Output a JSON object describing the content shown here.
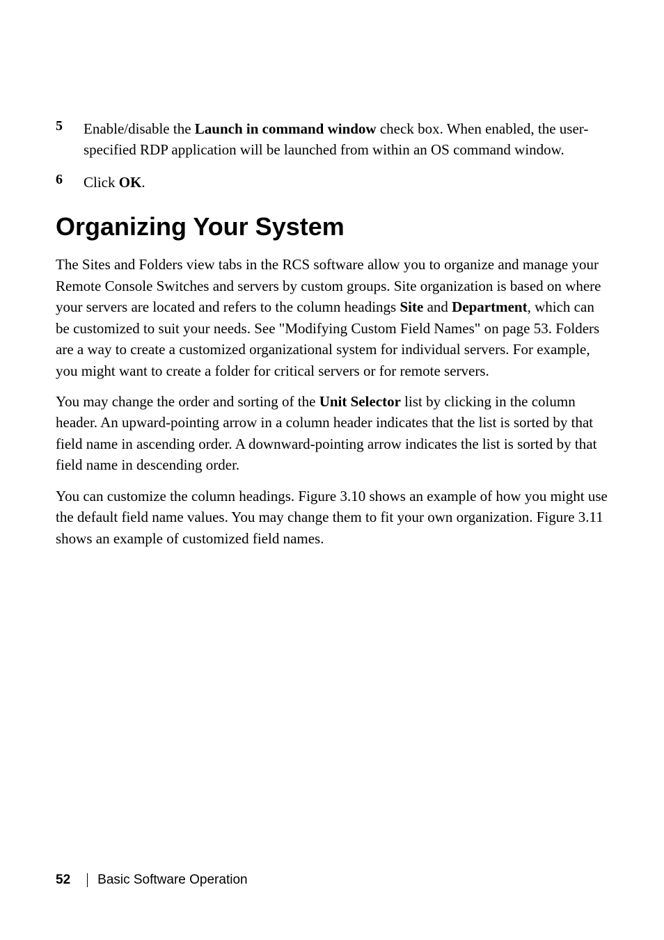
{
  "list": {
    "item5": {
      "number": "5",
      "prefix": "Enable/disable the ",
      "bold1": "Launch in command window",
      "suffix": " check box. When enabled, the user-specified RDP application will be launched from within an OS command window."
    },
    "item6": {
      "number": "6",
      "prefix": "Click ",
      "bold1": "OK",
      "suffix": "."
    }
  },
  "heading": "Organizing Your System",
  "paragraphs": {
    "p1": {
      "part1": "The Sites and Folders view tabs in the RCS software allow you to organize and manage your Remote Console Switches and servers by custom groups. Site organization is based on where your servers are located and refers to the column headings ",
      "bold1": "Site",
      "part2": " and ",
      "bold2": "Department",
      "part3": ", which can be customized to suit your needs. See \"Modifying Custom Field Names\" on page 53. Folders are a way to create a customized organizational system for individual servers. For example, you might want to create a folder for critical servers or for remote servers."
    },
    "p2": {
      "part1": "You may change the order and sorting of the ",
      "bold1": "Unit Selector",
      "part2": " list by clicking in the column header. An upward-pointing arrow in a column header indicates that the list is sorted by that field name in ascending order. A downward-pointing arrow indicates the list is sorted by that field name in descending order."
    },
    "p3": "You can customize the column headings. Figure 3.10 shows an example of how you might use the default field name values. You may change them to fit your own organization. Figure 3.11 shows an example of customized field names."
  },
  "footer": {
    "pageNumber": "52",
    "sectionName": "Basic Software Operation"
  }
}
